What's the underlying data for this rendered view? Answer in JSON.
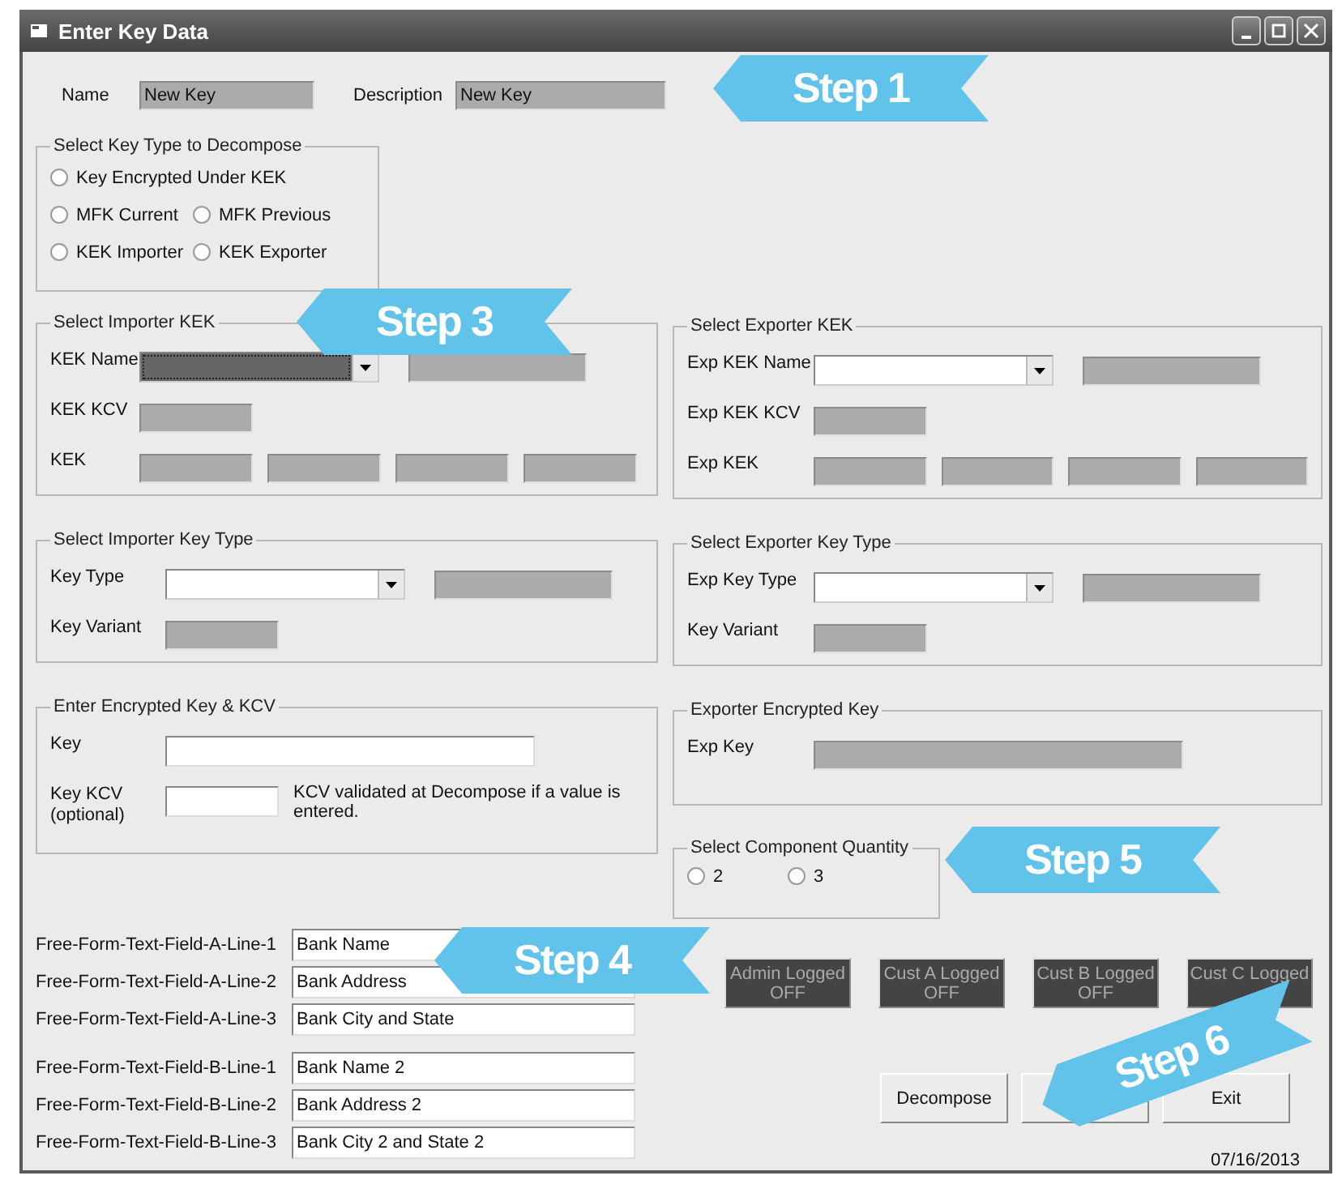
{
  "window": {
    "title": "Enter Key Data"
  },
  "header": [
    {
      "label": "Name",
      "value": "New Key"
    },
    {
      "label": "Description",
      "value": "New Key"
    }
  ],
  "key_type": {
    "title": "Select Key Type to Decompose",
    "rows": [
      [
        {
          "label": "Key Encrypted Under KEK",
          "selected": false
        }
      ],
      [
        {
          "label": "MFK Current",
          "selected": false
        },
        {
          "label": "MFK Previous",
          "selected": false
        }
      ],
      [
        {
          "label": "KEK Importer",
          "selected": false
        },
        {
          "label": "KEK Exporter",
          "selected": false
        }
      ]
    ]
  },
  "left_groups": [
    {
      "title": "Select Importer KEK",
      "rows": [
        {
          "label": "KEK Name",
          "controls": [
            {
              "kind": "combo",
              "focused": true
            },
            {
              "kind": "display-medium"
            }
          ]
        },
        {
          "label": "KEK KCV",
          "controls": [
            {
              "kind": "display-short"
            }
          ]
        },
        {
          "label": "KEK",
          "controls": [
            {
              "kind": "display-short"
            },
            {
              "kind": "display-short"
            },
            {
              "kind": "display-short"
            },
            {
              "kind": "display-short"
            }
          ]
        }
      ]
    },
    {
      "title": "Select Importer Key Type",
      "rows": [
        {
          "label": "Key Type",
          "controls": [
            {
              "kind": "combo",
              "focused": false
            },
            {
              "kind": "display-medium"
            }
          ]
        },
        {
          "label": "Key Variant",
          "controls": [
            {
              "kind": "display-short"
            }
          ]
        }
      ]
    },
    {
      "title": "Enter Encrypted Key & KCV",
      "rows": [
        {
          "label": "Key",
          "controls": [
            {
              "kind": "entry-long"
            }
          ]
        },
        {
          "label": "Key KCV (optional)",
          "controls": [
            {
              "kind": "entry-short"
            }
          ],
          "note": "KCV validated at Decompose if a value is entered."
        }
      ]
    }
  ],
  "free_form": [
    [
      {
        "label": "Free-Form-Text-Field-A-Line-1",
        "value": "Bank Name"
      },
      {
        "label": "Free-Form-Text-Field-A-Line-2",
        "value": "Bank Address"
      },
      {
        "label": "Free-Form-Text-Field-A-Line-3",
        "value": "Bank City and State"
      }
    ],
    [
      {
        "label": "Free-Form-Text-Field-B-Line-1",
        "value": "Bank Name 2"
      },
      {
        "label": "Free-Form-Text-Field-B-Line-2",
        "value": "Bank Address 2"
      },
      {
        "label": "Free-Form-Text-Field-B-Line-3",
        "value": "Bank City 2 and State 2"
      }
    ]
  ],
  "right_groups": [
    {
      "title": "Select Exporter KEK",
      "rows": [
        {
          "label": "Exp KEK Name",
          "controls": [
            {
              "kind": "combo",
              "focused": false
            },
            {
              "kind": "display-medium"
            }
          ]
        },
        {
          "label": "Exp KEK KCV",
          "controls": [
            {
              "kind": "display-short"
            }
          ]
        },
        {
          "label": "Exp KEK",
          "controls": [
            {
              "kind": "display-short"
            },
            {
              "kind": "display-short"
            },
            {
              "kind": "display-short"
            },
            {
              "kind": "display-short"
            }
          ]
        }
      ]
    },
    {
      "title": "Select Exporter Key Type",
      "rows": [
        {
          "label": "Exp Key Type",
          "controls": [
            {
              "kind": "combo",
              "focused": false
            },
            {
              "kind": "display-medium"
            }
          ]
        },
        {
          "label": "Key Variant",
          "controls": [
            {
              "kind": "display-short"
            }
          ]
        }
      ]
    },
    {
      "title": "Exporter Encrypted Key",
      "rows": [
        {
          "label": "Exp Key",
          "controls": [
            {
              "kind": "display-long"
            }
          ]
        }
      ]
    }
  ],
  "component_quantity": {
    "title": "Select Component Quantity",
    "options": [
      {
        "label": "2",
        "selected": false
      },
      {
        "label": "3",
        "selected": false
      }
    ]
  },
  "status_buttons": [
    {
      "lines": [
        "Admin Logged",
        "OFF"
      ]
    },
    {
      "lines": [
        "Cust A Logged",
        "OFF"
      ]
    },
    {
      "lines": [
        "Cust B Logged",
        "OFF"
      ]
    },
    {
      "lines": [
        "Cust C Logged"
      ]
    }
  ],
  "action_buttons": [
    {
      "kind": "labeled",
      "label": "Decompose"
    },
    {
      "kind": "covered"
    },
    {
      "kind": "labeled",
      "label": "Exit"
    }
  ],
  "date": "07/16/2013",
  "callouts": [
    {
      "label": "Step 1"
    },
    {
      "label": "Step 3"
    },
    {
      "label": "Step 4"
    },
    {
      "label": "Step 5"
    },
    {
      "label": "Step 6"
    }
  ]
}
